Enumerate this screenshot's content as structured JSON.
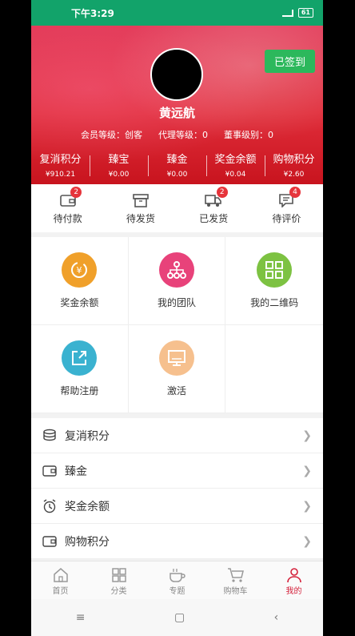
{
  "status": {
    "time": "下午3:29",
    "battery": "61"
  },
  "header": {
    "checkin_label": "已签到",
    "username": "黄远航",
    "levels": [
      "会员等级：创客",
      "代理等级：0",
      "董事级别：0"
    ],
    "balances": [
      {
        "label": "复消积分",
        "value": "¥910.21"
      },
      {
        "label": "臻宝",
        "value": "¥0.00"
      },
      {
        "label": "臻金",
        "value": "¥0.00"
      },
      {
        "label": "奖金余额",
        "value": "¥0.04"
      },
      {
        "label": "购物积分",
        "value": "¥2.60"
      }
    ]
  },
  "orders": [
    {
      "label": "待付款",
      "badge": "2",
      "icon": "wallet-icon"
    },
    {
      "label": "待发货",
      "badge": "",
      "icon": "box-icon"
    },
    {
      "label": "已发货",
      "badge": "2",
      "icon": "truck-icon"
    },
    {
      "label": "待评价",
      "badge": "4",
      "icon": "comment-icon"
    }
  ],
  "grid": [
    {
      "label": "奖金余额",
      "color": "#f0a02a",
      "icon": "yen-refresh-icon"
    },
    {
      "label": "我的团队",
      "color": "#e8427a",
      "icon": "team-tree-icon"
    },
    {
      "label": "我的二维码",
      "color": "#7dc242",
      "icon": "qrcode-icon"
    },
    {
      "label": "帮助注册",
      "color": "#3ab2d0",
      "icon": "share-icon"
    },
    {
      "label": "激活",
      "color": "#f6c08e",
      "icon": "monitor-icon"
    }
  ],
  "list": [
    {
      "label": "复消积分",
      "icon": "coins-icon"
    },
    {
      "label": "臻金",
      "icon": "wallet-icon"
    },
    {
      "label": "奖金余额",
      "icon": "alarm-icon"
    },
    {
      "label": "购物积分",
      "icon": "wallet-icon"
    }
  ],
  "tabs": [
    {
      "label": "首页",
      "icon": "home-icon",
      "active": false
    },
    {
      "label": "分类",
      "icon": "category-icon",
      "active": false
    },
    {
      "label": "专题",
      "icon": "coffee-icon",
      "active": false
    },
    {
      "label": "购物车",
      "icon": "cart-icon",
      "active": false
    },
    {
      "label": "我的",
      "icon": "user-icon",
      "active": true
    }
  ],
  "colors": {
    "accent": "#d4213b",
    "statusbar": "#12a36a",
    "checkin": "#2cb85c"
  }
}
